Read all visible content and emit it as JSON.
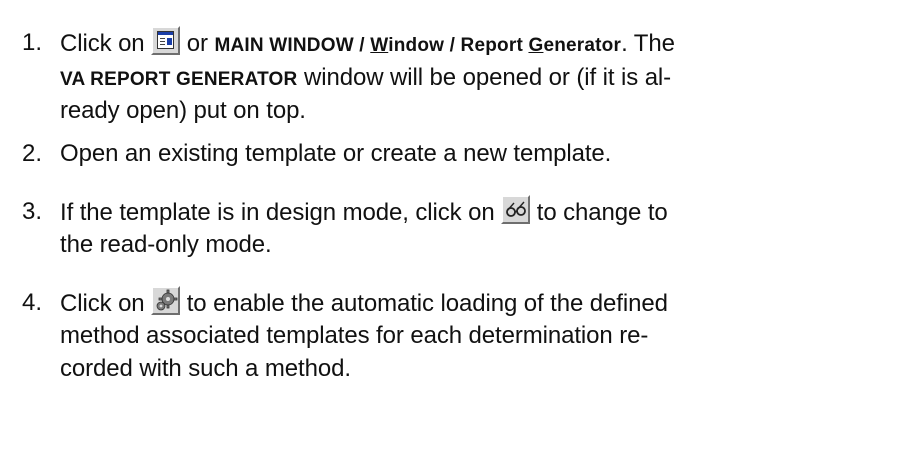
{
  "steps": [
    {
      "num": "1.",
      "t1": "Click on",
      "t2": "or",
      "menu_a": "MAIN WINDOW / ",
      "menu_b_u": "W",
      "menu_b": "indow / Report ",
      "menu_c_u": "G",
      "menu_c": "enerator",
      "t3": ". The",
      "b2": "VA REPORT GENERATOR",
      "t4": "window will be opened or (if it is al-",
      "t5": "ready open) put on top."
    },
    {
      "num": "2.",
      "t1": "Open an existing template or create a new template."
    },
    {
      "num": "3.",
      "t1": "If the template is in design mode, click on",
      "t2": "to change to",
      "t3": "the read-only mode."
    },
    {
      "num": "4.",
      "t1": "Click on",
      "t2": "to enable the automatic loading of the defined",
      "t3": "method associated templates for each determination re-",
      "t4": "corded with such a method."
    }
  ],
  "icons": {
    "report_generator": "report-generator-icon",
    "read_only": "glasses-icon",
    "auto_load": "gears-icon"
  }
}
